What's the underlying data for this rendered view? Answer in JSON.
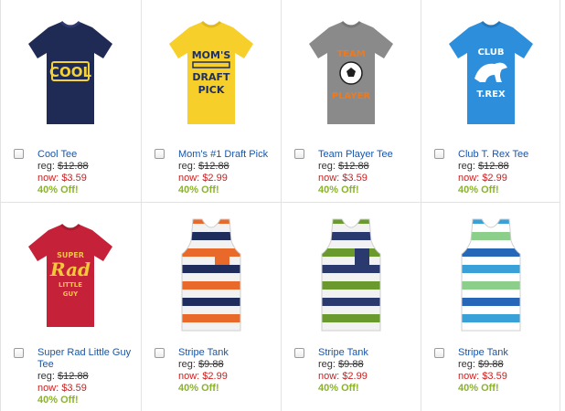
{
  "products": [
    {
      "name": "Cool Tee",
      "reg_label": "reg:",
      "reg_price": "$12.88",
      "now_label": "now:",
      "now_price": "$3.59",
      "discount": "40% Off!",
      "shirt_color": "#1f2a55",
      "graphic_text": "COOL",
      "graphic_color": "#f3d23a"
    },
    {
      "name": "Mom's #1 Draft Pick",
      "reg_label": "reg:",
      "reg_price": "$12.88",
      "now_label": "now:",
      "now_price": "$2.99",
      "discount": "40% Off!",
      "shirt_color": "#f6cf2a",
      "graphic_text": "MOM'S DRAFT PICK",
      "graphic_color": "#1d2f63"
    },
    {
      "name": "Team Player Tee",
      "reg_label": "reg:",
      "reg_price": "$12.88",
      "now_label": "now:",
      "now_price": "$3.59",
      "discount": "40% Off!",
      "shirt_color": "#8a8a8a",
      "graphic_text": "TEAM PLAYER",
      "graphic_color": "#ee7a1f"
    },
    {
      "name": "Club T. Rex Tee",
      "reg_label": "reg:",
      "reg_price": "$12.88",
      "now_label": "now:",
      "now_price": "$2.99",
      "discount": "40% Off!",
      "shirt_color": "#2d8fdc",
      "graphic_text": "CLUB T.REX",
      "graphic_color": "#ffffff"
    },
    {
      "name": "Super Rad Little Guy Tee",
      "reg_label": "reg:",
      "reg_price": "$12.88",
      "now_label": "now:",
      "now_price": "$3.59",
      "discount": "40% Off!",
      "shirt_color": "#c5223a",
      "graphic_text": "SUPER RAD LITTLE GUY",
      "graphic_color": "#f3c83a"
    },
    {
      "name": "Stripe Tank",
      "reg_label": "reg:",
      "reg_price": "$9.88",
      "now_label": "now:",
      "now_price": "$2.99",
      "discount": "40% Off!",
      "stripes": [
        "#e8692a",
        "#f2f2f2",
        "#1f2d5c",
        "#f2f2f2"
      ],
      "pocket_color": "#e8692a"
    },
    {
      "name": "Stripe Tank",
      "reg_label": "reg:",
      "reg_price": "$9.88",
      "now_label": "now:",
      "now_price": "$2.99",
      "discount": "40% Off!",
      "stripes": [
        "#6a9a2e",
        "#f2f2f2",
        "#2b3a6e",
        "#f2f2f2"
      ],
      "pocket_color": "#2b3a6e"
    },
    {
      "name": "Stripe Tank",
      "reg_label": "reg:",
      "reg_price": "$9.88",
      "now_label": "now:",
      "now_price": "$3.59",
      "discount": "40% Off!",
      "stripes": [
        "#3aa0d8",
        "#ffffff",
        "#8ccf8a",
        "#ffffff",
        "#2767b8",
        "#ffffff"
      ],
      "pocket_color": null
    }
  ]
}
